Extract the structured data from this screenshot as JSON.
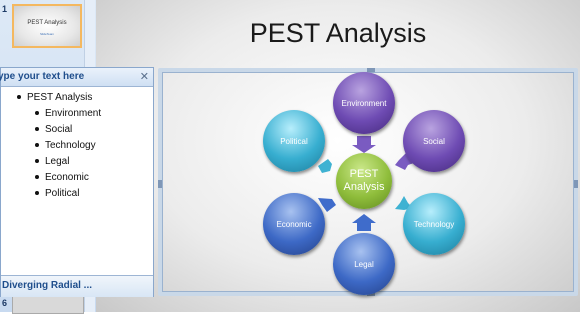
{
  "slides_panel": {
    "slide1_number": "1",
    "slide1_title": "PEST Analysis",
    "slide1_subtitle": "SlideTeam",
    "slide6_number": "6"
  },
  "slide": {
    "title": "PEST Analysis"
  },
  "text_pane": {
    "header": "ype your text here",
    "close_glyph": "✕",
    "items": [
      {
        "level": 1,
        "text": "PEST Analysis"
      },
      {
        "level": 2,
        "text": "Environment"
      },
      {
        "level": 2,
        "text": "Social"
      },
      {
        "level": 2,
        "text": "Technology"
      },
      {
        "level": 2,
        "text": "Legal"
      },
      {
        "level": 2,
        "text": "Economic"
      },
      {
        "level": 2,
        "text": "Political"
      }
    ],
    "footer": "Diverging Radial ..."
  },
  "smartart": {
    "layout": "Diverging Radial",
    "center": {
      "line1": "PEST",
      "line2": "Analysis",
      "color": "#8fbd3b"
    },
    "nodes": {
      "environment": {
        "label": "Environment",
        "color": "#6e4bb3"
      },
      "social": {
        "label": "Social",
        "color": "#6e4bb3"
      },
      "technology": {
        "label": "Technology",
        "color": "#37aed0"
      },
      "legal": {
        "label": "Legal",
        "color": "#3d69c6"
      },
      "economic": {
        "label": "Economic",
        "color": "#3d69c6"
      },
      "political": {
        "label": "Political",
        "color": "#37aed0"
      }
    }
  }
}
